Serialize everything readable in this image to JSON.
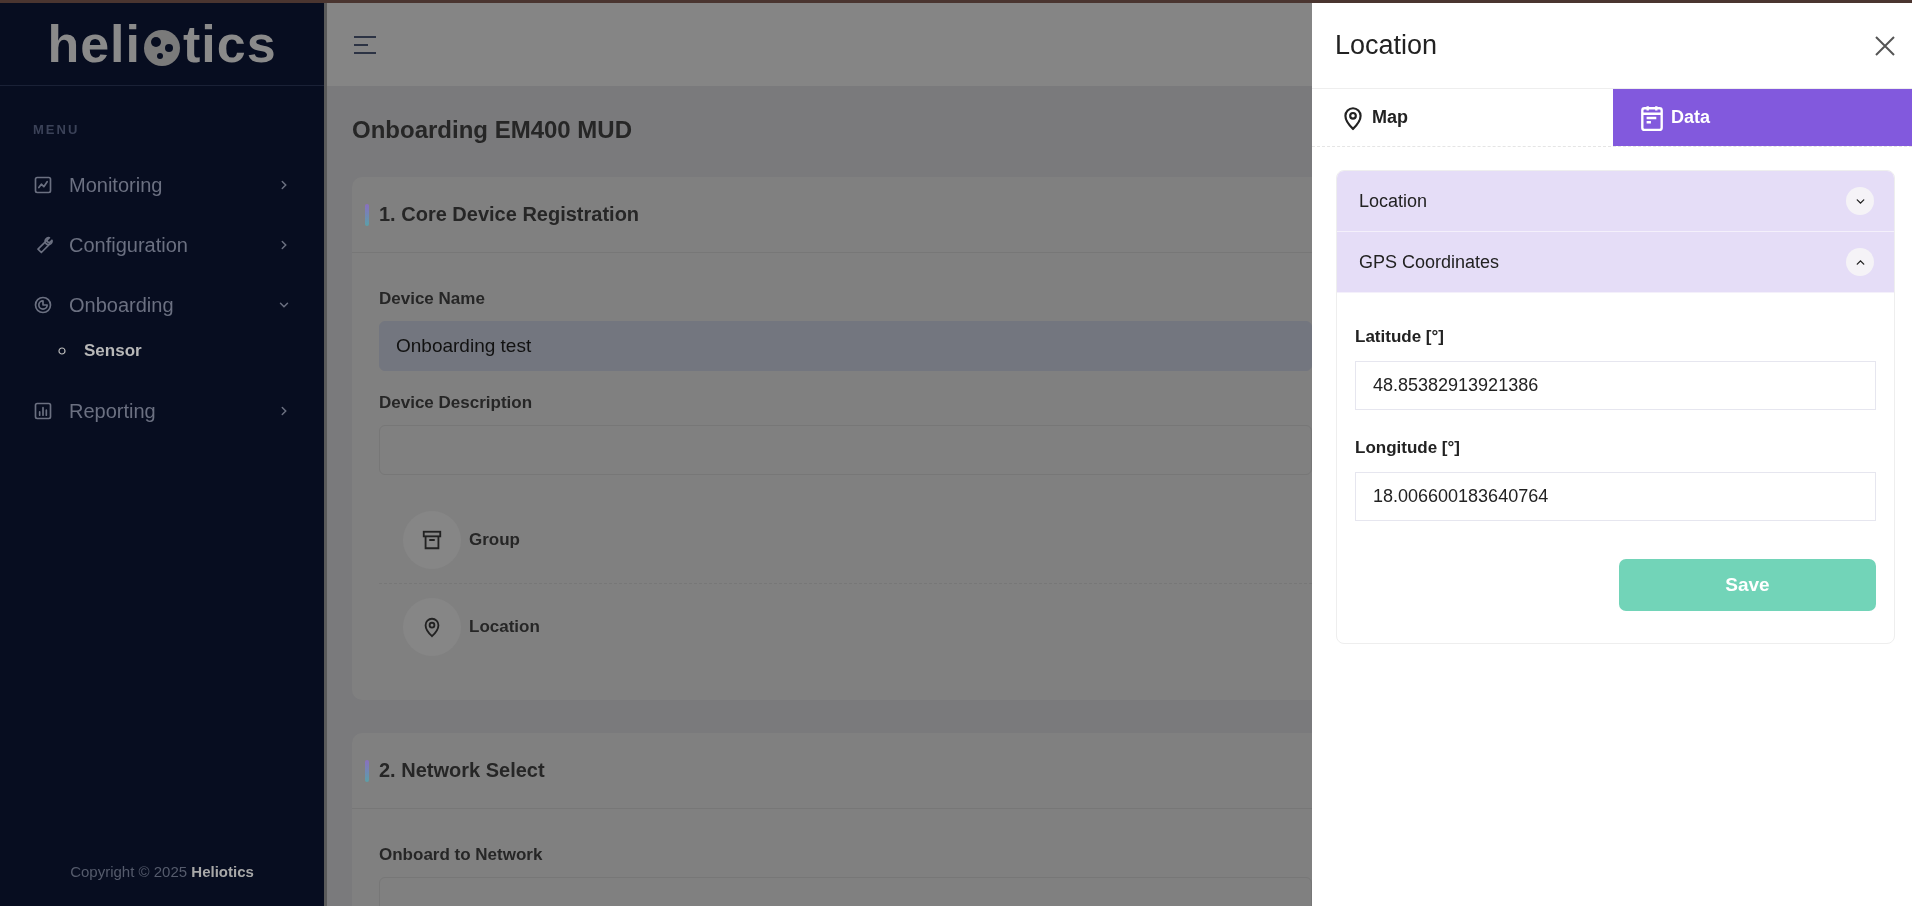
{
  "sidebar": {
    "logo": {
      "before": "heli",
      "after": "tics"
    },
    "menu_heading": "MENU",
    "items": [
      {
        "kind": "monitor",
        "label": "Monitoring",
        "expanded": false
      },
      {
        "kind": "wrench",
        "label": "Configuration",
        "expanded": false
      },
      {
        "kind": "gauge",
        "label": "Onboarding",
        "expanded": true,
        "children": [
          {
            "label": "Sensor",
            "selected": true
          }
        ]
      },
      {
        "kind": "chart",
        "label": "Reporting",
        "expanded": false
      }
    ],
    "copyright": {
      "text": "Copyright © 2025",
      "brand": "Heliotics"
    }
  },
  "page": {
    "title": "Onboarding EM400 MUD",
    "cards": [
      {
        "title": "1. Core Device Registration",
        "fields": [
          {
            "label": "Device Name",
            "value": "Onboarding test",
            "disabled": true
          },
          {
            "label": "Device Description",
            "disabled": false
          }
        ],
        "actions": [
          {
            "kind": "archive",
            "label": "Group"
          },
          {
            "kind": "pin",
            "label": "Location"
          }
        ]
      },
      {
        "title": "2. Network Select",
        "fields": [
          {
            "label": "Onboard to Network",
            "disabled": false
          }
        ]
      }
    ]
  },
  "drawer": {
    "title": "Location",
    "tabs": [
      {
        "kind": "pin",
        "label": "Map",
        "selected": false
      },
      {
        "kind": "calendar",
        "label": "Data",
        "selected": true
      }
    ],
    "accordion": [
      {
        "title": "Location",
        "expanded": false
      },
      {
        "title": "GPS Coordinates",
        "expanded": true,
        "fields": [
          {
            "label": "Latitude [°]",
            "value": "48.85382913921386"
          },
          {
            "label": "Longitude [°]",
            "value": "18.006600183640764"
          }
        ],
        "save_button": "Save"
      }
    ]
  }
}
